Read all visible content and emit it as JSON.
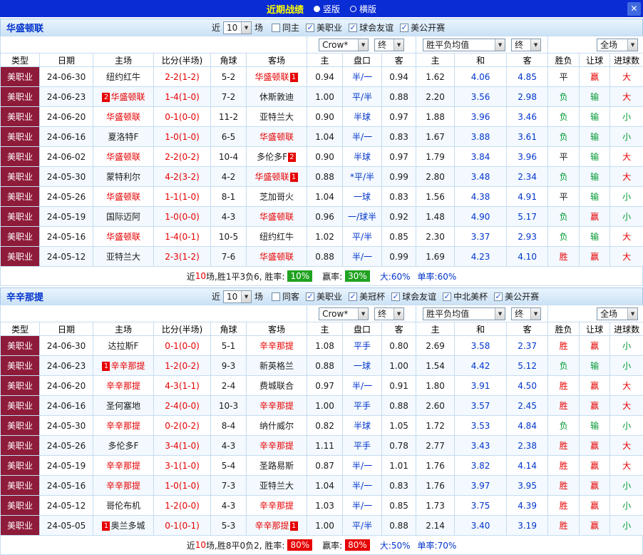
{
  "topbar": {
    "title": "近期战绩",
    "radios": [
      {
        "label": "竖版",
        "selected": true
      },
      {
        "label": "横版",
        "selected": false
      }
    ],
    "close_label": "✕"
  },
  "icons": {
    "chevron_down": "▼",
    "check": "✓"
  },
  "colors": {
    "topbar_blue": "#0a2cd4",
    "accent_blue": "#0035cc",
    "red": "#e60000",
    "green": "#009933",
    "league_maroon": "#8e1b3a",
    "result_map": {
      "胜": "red",
      "平": "black",
      "负": "green",
      "赢": "red",
      "输": "green",
      "大": "red",
      "小": "green"
    }
  },
  "table_columns": [
    "类型",
    "日期",
    "主场",
    "比分(半场)",
    "角球",
    "客场",
    "主",
    "盘口",
    "客",
    "主",
    "和",
    "客",
    "胜负",
    "让球",
    "进球数"
  ],
  "sections": [
    {
      "team": "华盛顿联",
      "filter": {
        "near": "近",
        "count": "10",
        "games": "场",
        "checkboxes": [
          {
            "label": "同主",
            "checked": false
          },
          {
            "label": "美职业",
            "checked": true
          },
          {
            "label": "球会友谊",
            "checked": true
          },
          {
            "label": "美公开赛",
            "checked": true
          }
        ]
      },
      "dropdowns": {
        "bookmaker": "Crow*",
        "final_a": "终",
        "avg": "胜平负均值",
        "final_b": "终",
        "scope": "全场"
      },
      "rows": [
        {
          "type": "美职业",
          "date": "24-06-30",
          "home": {
            "name": "纽约红牛",
            "focus": false,
            "badge": "",
            "badge_side": ""
          },
          "score": "2-2(1-2)",
          "corner": "5-2",
          "away": {
            "name": "华盛顿联",
            "focus": true,
            "badge": "1",
            "badge_side": "after"
          },
          "odds": [
            "0.94",
            "半/一",
            "0.94"
          ],
          "avg": [
            "1.62",
            "4.06",
            "4.85"
          ],
          "wdl": "平",
          "let": "赢",
          "size": "大"
        },
        {
          "type": "美职业",
          "date": "24-06-23",
          "home": {
            "name": "华盛顿联",
            "focus": true,
            "badge": "2",
            "badge_side": "before"
          },
          "score": "1-4(1-0)",
          "corner": "7-2",
          "away": {
            "name": "休斯敦迪",
            "focus": false,
            "badge": "",
            "badge_side": ""
          },
          "odds": [
            "1.00",
            "平/半",
            "0.88"
          ],
          "avg": [
            "2.20",
            "3.56",
            "2.98"
          ],
          "wdl": "负",
          "let": "输",
          "size": "大"
        },
        {
          "type": "美职业",
          "date": "24-06-20",
          "home": {
            "name": "华盛顿联",
            "focus": true,
            "badge": "",
            "badge_side": ""
          },
          "score": "0-1(0-0)",
          "corner": "11-2",
          "away": {
            "name": "亚特兰大",
            "focus": false,
            "badge": "",
            "badge_side": ""
          },
          "odds": [
            "0.90",
            "半球",
            "0.97"
          ],
          "avg": [
            "1.88",
            "3.96",
            "3.46"
          ],
          "wdl": "负",
          "let": "输",
          "size": "小"
        },
        {
          "type": "美职业",
          "date": "24-06-16",
          "home": {
            "name": "夏洛特F",
            "focus": false,
            "badge": "",
            "badge_side": ""
          },
          "score": "1-0(1-0)",
          "corner": "6-5",
          "away": {
            "name": "华盛顿联",
            "focus": true,
            "badge": "",
            "badge_side": ""
          },
          "odds": [
            "1.04",
            "半/一",
            "0.83"
          ],
          "avg": [
            "1.67",
            "3.88",
            "3.61"
          ],
          "wdl": "负",
          "let": "输",
          "size": "小"
        },
        {
          "type": "美职业",
          "date": "24-06-02",
          "home": {
            "name": "华盛顿联",
            "focus": true,
            "badge": "",
            "badge_side": ""
          },
          "score": "2-2(0-2)",
          "corner": "10-4",
          "away": {
            "name": "多伦多F",
            "focus": false,
            "badge": "2",
            "badge_side": "after"
          },
          "odds": [
            "0.90",
            "半球",
            "0.97"
          ],
          "avg": [
            "1.79",
            "3.84",
            "3.96"
          ],
          "wdl": "平",
          "let": "输",
          "size": "大"
        },
        {
          "type": "美职业",
          "date": "24-05-30",
          "home": {
            "name": "蒙特利尔",
            "focus": false,
            "badge": "",
            "badge_side": ""
          },
          "score": "4-2(3-2)",
          "corner": "4-2",
          "away": {
            "name": "华盛顿联",
            "focus": true,
            "badge": "1",
            "badge_side": "after"
          },
          "odds": [
            "0.88",
            "*平/半",
            "0.99"
          ],
          "avg": [
            "2.80",
            "3.48",
            "2.34"
          ],
          "wdl": "负",
          "let": "输",
          "size": "大"
        },
        {
          "type": "美职业",
          "date": "24-05-26",
          "home": {
            "name": "华盛顿联",
            "focus": true,
            "badge": "",
            "badge_side": ""
          },
          "score": "1-1(1-0)",
          "corner": "8-1",
          "away": {
            "name": "芝加哥火",
            "focus": false,
            "badge": "",
            "badge_side": ""
          },
          "odds": [
            "1.04",
            "一球",
            "0.83"
          ],
          "avg": [
            "1.56",
            "4.38",
            "4.91"
          ],
          "wdl": "平",
          "let": "输",
          "size": "小"
        },
        {
          "type": "美职业",
          "date": "24-05-19",
          "home": {
            "name": "国际迈阿",
            "focus": false,
            "badge": "",
            "badge_side": ""
          },
          "score": "1-0(0-0)",
          "corner": "4-3",
          "away": {
            "name": "华盛顿联",
            "focus": true,
            "badge": "",
            "badge_side": ""
          },
          "odds": [
            "0.96",
            "一/球半",
            "0.92"
          ],
          "avg": [
            "1.48",
            "4.90",
            "5.17"
          ],
          "wdl": "负",
          "let": "赢",
          "size": "小"
        },
        {
          "type": "美职业",
          "date": "24-05-16",
          "home": {
            "name": "华盛顿联",
            "focus": true,
            "badge": "",
            "badge_side": ""
          },
          "score": "1-4(0-1)",
          "corner": "10-5",
          "away": {
            "name": "纽约红牛",
            "focus": false,
            "badge": "",
            "badge_side": ""
          },
          "odds": [
            "1.02",
            "平/半",
            "0.85"
          ],
          "avg": [
            "2.30",
            "3.37",
            "2.93"
          ],
          "wdl": "负",
          "let": "输",
          "size": "大"
        },
        {
          "type": "美职业",
          "date": "24-05-12",
          "home": {
            "name": "亚特兰大",
            "focus": false,
            "badge": "",
            "badge_side": ""
          },
          "score": "2-3(1-2)",
          "corner": "7-6",
          "away": {
            "name": "华盛顿联",
            "focus": true,
            "badge": "",
            "badge_side": ""
          },
          "odds": [
            "0.88",
            "半/一",
            "0.99"
          ],
          "avg": [
            "1.69",
            "4.23",
            "4.10"
          ],
          "wdl": "胜",
          "let": "赢",
          "size": "大"
        }
      ],
      "summary": {
        "pre": "近",
        "count": "10",
        "mid": "场,胜1平3负6, 胜率:",
        "win_rate": "10%",
        "label2": "赢率:",
        "profit_rate": "30%",
        "badge_color": "green",
        "big": "大:60%",
        "single": "单率:60%"
      }
    },
    {
      "team": "辛辛那提",
      "filter": {
        "near": "近",
        "count": "10",
        "games": "场",
        "checkboxes": [
          {
            "label": "同客",
            "checked": false
          },
          {
            "label": "美职业",
            "checked": true
          },
          {
            "label": "美冠杯",
            "checked": true
          },
          {
            "label": "球会友谊",
            "checked": true
          },
          {
            "label": "中北美杯",
            "checked": true
          },
          {
            "label": "美公开赛",
            "checked": true
          }
        ]
      },
      "dropdowns": {
        "bookmaker": "Crow*",
        "final_a": "终",
        "avg": "胜平负均值",
        "final_b": "终",
        "scope": "全场"
      },
      "rows": [
        {
          "type": "美职业",
          "date": "24-06-30",
          "home": {
            "name": "达拉斯F",
            "focus": false,
            "badge": "",
            "badge_side": ""
          },
          "score": "0-1(0-0)",
          "corner": "5-1",
          "away": {
            "name": "辛辛那提",
            "focus": true,
            "badge": "",
            "badge_side": ""
          },
          "odds": [
            "1.08",
            "平手",
            "0.80"
          ],
          "avg": [
            "2.69",
            "3.58",
            "2.37"
          ],
          "wdl": "胜",
          "let": "赢",
          "size": "小"
        },
        {
          "type": "美职业",
          "date": "24-06-23",
          "home": {
            "name": "辛辛那提",
            "focus": true,
            "badge": "1",
            "badge_side": "before"
          },
          "score": "1-2(0-2)",
          "corner": "9-3",
          "away": {
            "name": "新英格兰",
            "focus": false,
            "badge": "",
            "badge_side": ""
          },
          "odds": [
            "0.88",
            "一球",
            "1.00"
          ],
          "avg": [
            "1.54",
            "4.42",
            "5.12"
          ],
          "wdl": "负",
          "let": "输",
          "size": "小"
        },
        {
          "type": "美职业",
          "date": "24-06-20",
          "home": {
            "name": "辛辛那提",
            "focus": true,
            "badge": "",
            "badge_side": ""
          },
          "score": "4-3(1-1)",
          "corner": "2-4",
          "away": {
            "name": "费城联合",
            "focus": false,
            "badge": "",
            "badge_side": ""
          },
          "odds": [
            "0.97",
            "半/一",
            "0.91"
          ],
          "avg": [
            "1.80",
            "3.91",
            "4.50"
          ],
          "wdl": "胜",
          "let": "赢",
          "size": "大"
        },
        {
          "type": "美职业",
          "date": "24-06-16",
          "home": {
            "name": "圣何塞地",
            "focus": false,
            "badge": "",
            "badge_side": ""
          },
          "score": "2-4(0-0)",
          "corner": "10-3",
          "away": {
            "name": "辛辛那提",
            "focus": true,
            "badge": "",
            "badge_side": ""
          },
          "odds": [
            "1.00",
            "平手",
            "0.88"
          ],
          "avg": [
            "2.60",
            "3.57",
            "2.45"
          ],
          "wdl": "胜",
          "let": "赢",
          "size": "大"
        },
        {
          "type": "美职业",
          "date": "24-05-30",
          "home": {
            "name": "辛辛那提",
            "focus": true,
            "badge": "",
            "badge_side": ""
          },
          "score": "0-2(0-2)",
          "corner": "8-4",
          "away": {
            "name": "纳什威尔",
            "focus": false,
            "badge": "",
            "badge_side": ""
          },
          "odds": [
            "0.82",
            "半球",
            "1.05"
          ],
          "avg": [
            "1.72",
            "3.53",
            "4.84"
          ],
          "wdl": "负",
          "let": "输",
          "size": "小"
        },
        {
          "type": "美职业",
          "date": "24-05-26",
          "home": {
            "name": "多伦多F",
            "focus": false,
            "badge": "",
            "badge_side": ""
          },
          "score": "3-4(1-0)",
          "corner": "4-3",
          "away": {
            "name": "辛辛那提",
            "focus": true,
            "badge": "",
            "badge_side": ""
          },
          "odds": [
            "1.11",
            "平手",
            "0.78"
          ],
          "avg": [
            "2.77",
            "3.43",
            "2.38"
          ],
          "wdl": "胜",
          "let": "赢",
          "size": "大"
        },
        {
          "type": "美职业",
          "date": "24-05-19",
          "home": {
            "name": "辛辛那提",
            "focus": true,
            "badge": "",
            "badge_side": ""
          },
          "score": "3-1(1-0)",
          "corner": "5-4",
          "away": {
            "name": "圣路易斯",
            "focus": false,
            "badge": "",
            "badge_side": ""
          },
          "odds": [
            "0.87",
            "半/一",
            "1.01"
          ],
          "avg": [
            "1.76",
            "3.82",
            "4.14"
          ],
          "wdl": "胜",
          "let": "赢",
          "size": "大"
        },
        {
          "type": "美职业",
          "date": "24-05-16",
          "home": {
            "name": "辛辛那提",
            "focus": true,
            "badge": "",
            "badge_side": ""
          },
          "score": "1-0(1-0)",
          "corner": "7-3",
          "away": {
            "name": "亚特兰大",
            "focus": false,
            "badge": "",
            "badge_side": ""
          },
          "odds": [
            "1.04",
            "半/一",
            "0.83"
          ],
          "avg": [
            "1.76",
            "3.97",
            "3.95"
          ],
          "wdl": "胜",
          "let": "赢",
          "size": "小"
        },
        {
          "type": "美职业",
          "date": "24-05-12",
          "home": {
            "name": "哥伦布机",
            "focus": false,
            "badge": "",
            "badge_side": ""
          },
          "score": "1-2(0-0)",
          "corner": "4-3",
          "away": {
            "name": "辛辛那提",
            "focus": true,
            "badge": "",
            "badge_side": ""
          },
          "odds": [
            "1.03",
            "半/一",
            "0.85"
          ],
          "avg": [
            "1.73",
            "3.75",
            "4.39"
          ],
          "wdl": "胜",
          "let": "赢",
          "size": "小"
        },
        {
          "type": "美职业",
          "date": "24-05-05",
          "home": {
            "name": "奥兰多城",
            "focus": false,
            "badge": "1",
            "badge_side": "before"
          },
          "score": "0-1(0-1)",
          "corner": "5-3",
          "away": {
            "name": "辛辛那提",
            "focus": true,
            "badge": "1",
            "badge_side": "after"
          },
          "odds": [
            "1.00",
            "平/半",
            "0.88"
          ],
          "avg": [
            "2.14",
            "3.40",
            "3.19"
          ],
          "wdl": "胜",
          "let": "赢",
          "size": "小"
        }
      ],
      "summary": {
        "pre": "近",
        "count": "10",
        "mid": "场,胜8平0负2, 胜率:",
        "win_rate": "80%",
        "label2": "赢率:",
        "profit_rate": "80%",
        "badge_color": "red",
        "big": "大:50%",
        "single": "单率:70%"
      }
    }
  ]
}
